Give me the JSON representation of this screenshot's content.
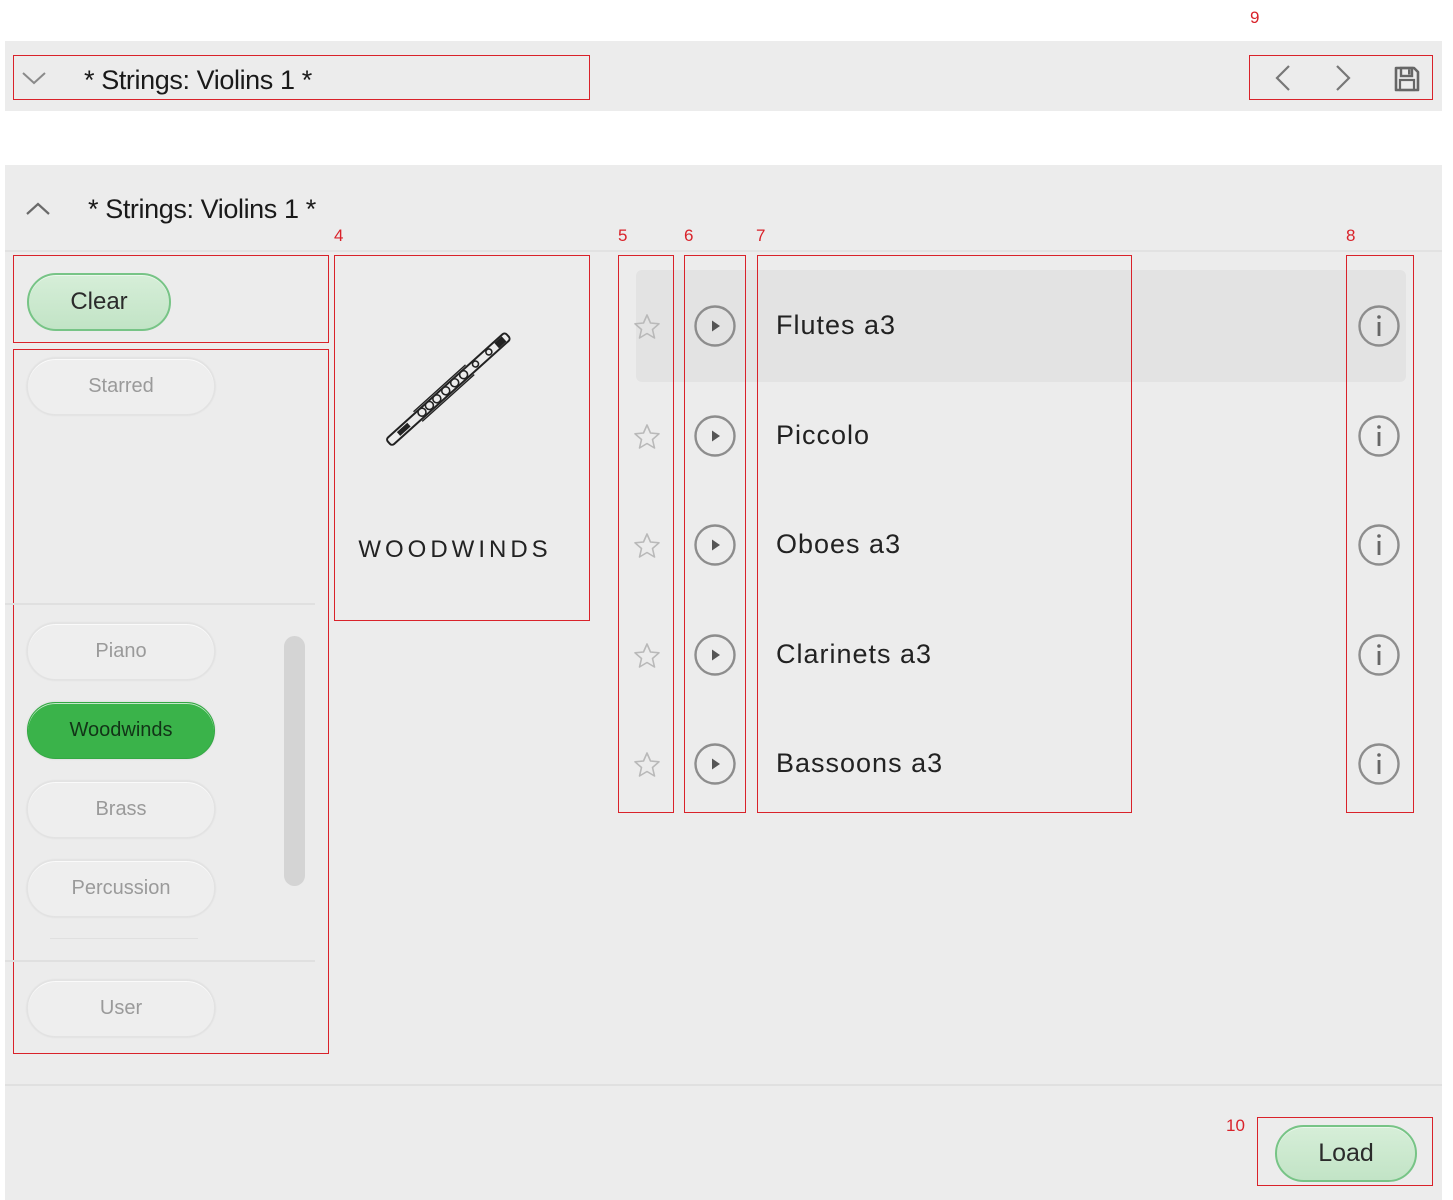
{
  "callouts": {
    "c4": "4",
    "c5": "5",
    "c6": "6",
    "c7": "7",
    "c8": "8",
    "c9": "9",
    "c10": "10"
  },
  "topbar": {
    "title": "* Strings: Violins 1 *",
    "collapse_icon": "chevron-down-icon",
    "prev_icon": "chevron-left-icon",
    "next_icon": "chevron-right-icon",
    "save_icon": "save-icon"
  },
  "panel": {
    "title": "* Strings: Violins 1 *",
    "expand_icon": "chevron-up-icon"
  },
  "filters": {
    "clear_label": "Clear",
    "starred_label": "Starred",
    "categories": [
      {
        "label": "Piano",
        "active": false
      },
      {
        "label": "Woodwinds",
        "active": true
      },
      {
        "label": "Brass",
        "active": false
      },
      {
        "label": "Percussion",
        "active": false
      }
    ],
    "user_label": "User"
  },
  "category_card": {
    "label": "WOODWINDS",
    "image_icon": "flute-icon"
  },
  "instruments": [
    {
      "name": "Flutes a3",
      "selected": true
    },
    {
      "name": "Piccolo",
      "selected": false
    },
    {
      "name": "Oboes a3",
      "selected": false
    },
    {
      "name": "Clarinets a3",
      "selected": false
    },
    {
      "name": "Bassoons a3",
      "selected": false
    }
  ],
  "footer": {
    "load_label": "Load"
  },
  "colors": {
    "accent_green": "#3ab34a",
    "light_green": "#c8e8cb",
    "annotation_red": "#d9222a"
  }
}
